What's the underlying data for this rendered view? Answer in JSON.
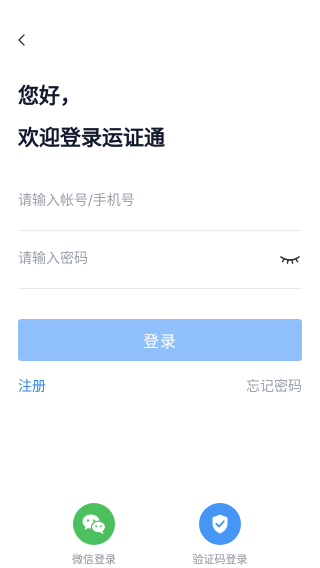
{
  "header": {
    "back_icon": "chevron-left-icon"
  },
  "title": {
    "greeting": "您好，",
    "welcome": "欢迎登录运证通"
  },
  "form": {
    "account_placeholder": "请输入帐号/手机号",
    "account_value": "",
    "password_placeholder": "请输入密码",
    "password_value": "",
    "password_visibility_icon": "eye-closed-icon",
    "login_label": "登录"
  },
  "links": {
    "register": "注册",
    "forgot_password": "忘记密码"
  },
  "alt_login": {
    "wechat_label": "微信登录",
    "wechat_icon": "wechat-icon",
    "sms_label": "验证码登录",
    "sms_icon": "shield-check-icon"
  },
  "colors": {
    "primary": "#2f86f0",
    "button_disabled": "#8fc0fb",
    "wechat_green": "#4cbf5e",
    "shield_blue": "#4596f5",
    "title_text": "#121a2e",
    "placeholder": "#9aa0ab"
  }
}
